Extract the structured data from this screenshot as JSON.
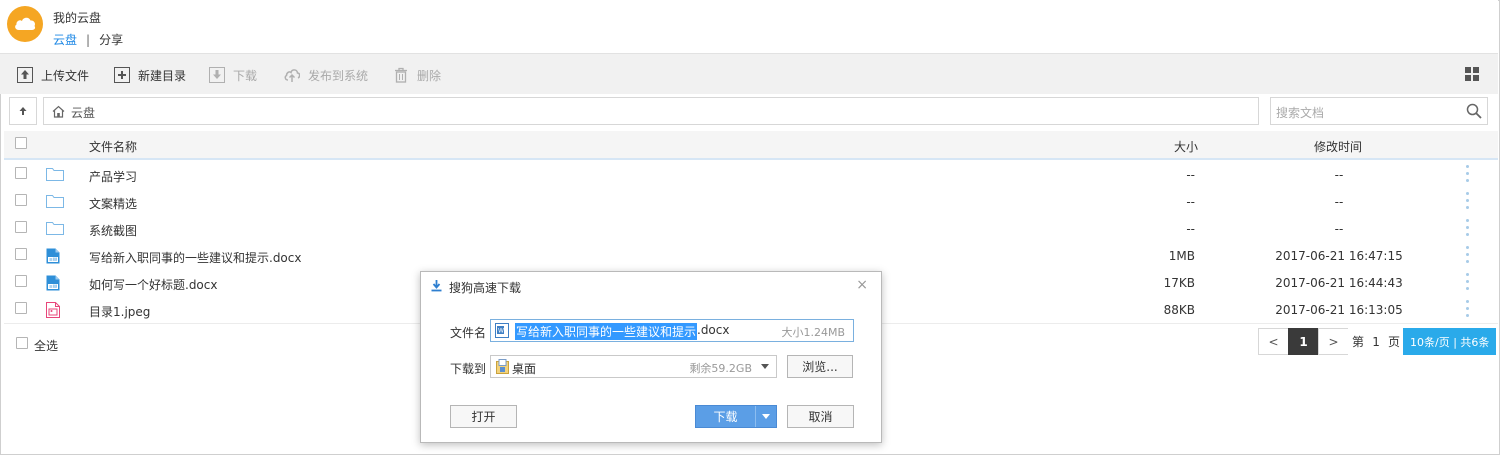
{
  "header": {
    "app_title": "我的云盘",
    "nav_current": "云盘",
    "nav_separator": "|",
    "nav_share": "分享"
  },
  "toolbar": {
    "upload": "上传文件",
    "new_folder": "新建目录",
    "download": "下载",
    "publish": "发布到系统",
    "delete": "删除"
  },
  "path": {
    "crumb": "云盘"
  },
  "search": {
    "placeholder": "搜索文档"
  },
  "table": {
    "col_name": "文件名称",
    "col_size": "大小",
    "col_time": "修改时间",
    "rows": [
      {
        "name": "产品学习",
        "type": "folder",
        "size": "--",
        "time": "--"
      },
      {
        "name": "文案精选",
        "type": "folder",
        "size": "--",
        "time": "--"
      },
      {
        "name": "系统截图",
        "type": "folder",
        "size": "--",
        "time": "--"
      },
      {
        "name": "写给新入职同事的一些建议和提示.docx",
        "type": "docx",
        "size": "1MB",
        "time": "2017-06-21 16:47:15"
      },
      {
        "name": "如何写一个好标题.docx",
        "type": "docx",
        "size": "17KB",
        "time": "2017-06-21 16:44:43"
      },
      {
        "name": "目录1.jpeg",
        "type": "image",
        "size": "88KB",
        "time": "2017-06-21 16:13:05"
      }
    ]
  },
  "footer": {
    "select_all": "全选"
  },
  "pager": {
    "prev": "<",
    "current": "1",
    "next": ">",
    "page_prefix": "第",
    "page_input": "1",
    "page_suffix": "页",
    "summary": "10条/页 | 共6条"
  },
  "dialog": {
    "title": "搜狗高速下载",
    "close": "×",
    "filename_label": "文件名",
    "filename_selected": "写给新入职同事的一些建议和提示",
    "filename_ext": ".docx",
    "filesize": "大小1.24MB",
    "dest_label": "下载到",
    "dest_value": "桌面",
    "dest_free": "剩余59.2GB",
    "browse": "浏览...",
    "open": "打开",
    "download": "下载",
    "cancel": "取消"
  },
  "colors": {
    "accent": "#1e88e5",
    "logo": "#f5a623",
    "pager_summary": "#2aaaea",
    "primary_button": "#5b9ee6"
  }
}
